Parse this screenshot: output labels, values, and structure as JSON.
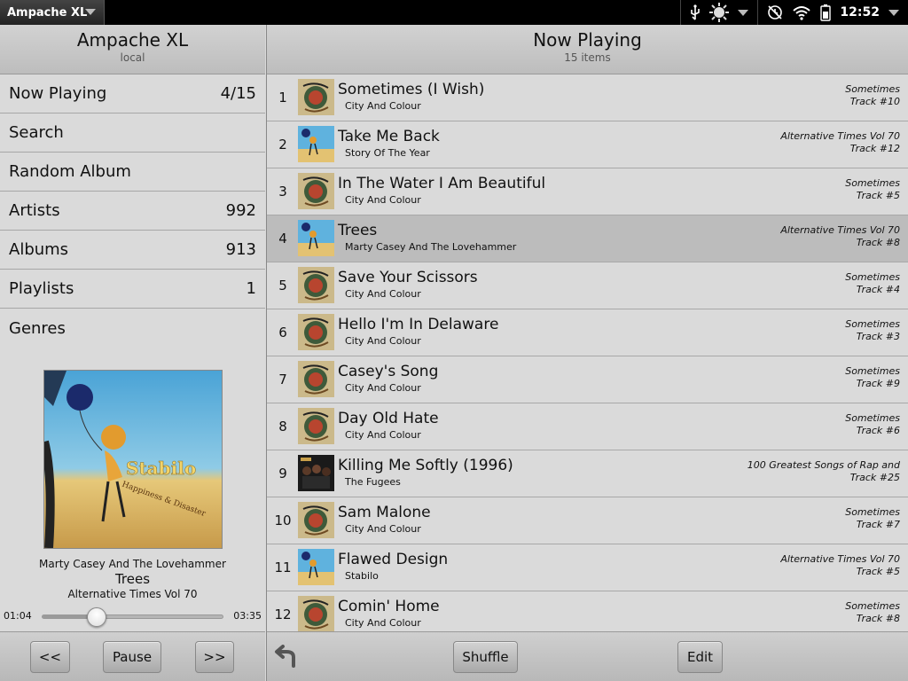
{
  "status_bar": {
    "app_name": "Ampache XL",
    "time": "12:52",
    "icons": [
      "usb-icon",
      "brightness-icon",
      "clock-icon",
      "wifi-icon",
      "battery-icon"
    ]
  },
  "left_pane": {
    "title": "Ampache XL",
    "subtitle": "local",
    "menu": [
      {
        "label": "Now Playing",
        "count": "4/15"
      },
      {
        "label": "Search",
        "count": ""
      },
      {
        "label": "Random Album",
        "count": ""
      },
      {
        "label": "Artists",
        "count": "992"
      },
      {
        "label": "Albums",
        "count": "913"
      },
      {
        "label": "Playlists",
        "count": "1"
      },
      {
        "label": "Genres",
        "count": ""
      }
    ],
    "now_playing": {
      "art_text": "Stabilo",
      "art_subtext": "Happiness & Disaster",
      "artist": "Marty Casey And The Lovehammer",
      "track": "Trees",
      "album": "Alternative Times Vol 70",
      "elapsed": "01:04",
      "duration": "03:35",
      "progress": 0.3
    },
    "controls": {
      "prev": "<<",
      "pause": "Pause",
      "next": ">>"
    }
  },
  "right_pane": {
    "title": "Now Playing",
    "subtitle": "15 items",
    "tracks": [
      {
        "num": "1",
        "title": "Sometimes (I Wish)",
        "artist": "City And Colour",
        "album": "Sometimes",
        "track": "Track #10",
        "art": "cityandcolour"
      },
      {
        "num": "2",
        "title": "Take Me Back",
        "artist": "Story Of The Year",
        "album": "Alternative Times Vol 70",
        "track": "Track #12",
        "art": "alttimes"
      },
      {
        "num": "3",
        "title": "In The Water I Am Beautiful",
        "artist": "City And Colour",
        "album": "Sometimes",
        "track": "Track #5",
        "art": "cityandcolour"
      },
      {
        "num": "4",
        "title": "Trees",
        "artist": "Marty Casey And The Lovehammer",
        "album": "Alternative Times Vol 70",
        "track": "Track #8",
        "art": "alttimes",
        "selected": true
      },
      {
        "num": "5",
        "title": "Save Your Scissors",
        "artist": "City And Colour",
        "album": "Sometimes",
        "track": "Track #4",
        "art": "cityandcolour"
      },
      {
        "num": "6",
        "title": "Hello I'm In Delaware",
        "artist": "City And Colour",
        "album": "Sometimes",
        "track": "Track #3",
        "art": "cityandcolour"
      },
      {
        "num": "7",
        "title": "Casey's Song",
        "artist": "City And Colour",
        "album": "Sometimes",
        "track": "Track #9",
        "art": "cityandcolour"
      },
      {
        "num": "8",
        "title": "Day Old Hate",
        "artist": "City And Colour",
        "album": "Sometimes",
        "track": "Track #6",
        "art": "cityandcolour"
      },
      {
        "num": "9",
        "title": "Killing Me Softly (1996)",
        "artist": "The Fugees",
        "album": "100 Greatest Songs of Rap and",
        "track": "Track #25",
        "art": "fugees"
      },
      {
        "num": "10",
        "title": "Sam Malone",
        "artist": "City And Colour",
        "album": "Sometimes",
        "track": "Track #7",
        "art": "cityandcolour"
      },
      {
        "num": "11",
        "title": "Flawed Design",
        "artist": "Stabilo",
        "album": "Alternative Times Vol 70",
        "track": "Track #5",
        "art": "alttimes"
      },
      {
        "num": "12",
        "title": "Comin' Home",
        "artist": "City And Colour",
        "album": "Sometimes",
        "track": "Track #8",
        "art": "cityandcolour"
      }
    ],
    "toolbar": {
      "shuffle": "Shuffle",
      "edit": "Edit"
    }
  }
}
